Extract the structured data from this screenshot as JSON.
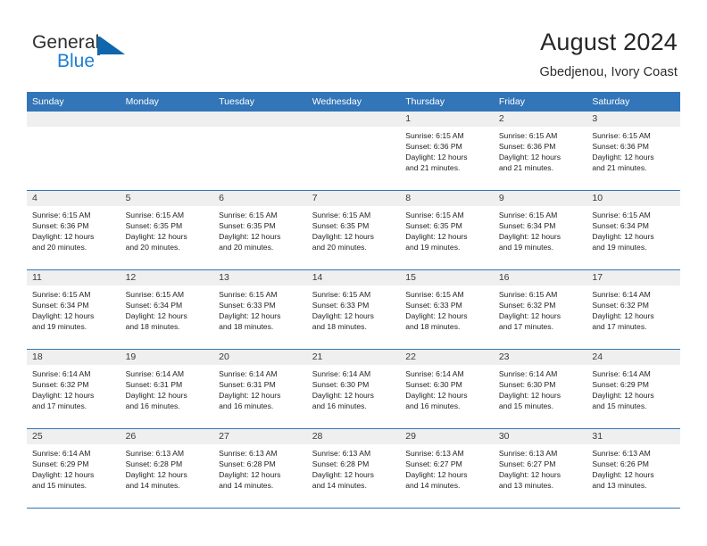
{
  "logo": {
    "text_primary": "General",
    "text_secondary": "Blue",
    "flag_icon": "blue-triangle-flag-icon",
    "accent_color": "#1b7fd4"
  },
  "header": {
    "title": "August 2024",
    "subtitle": "Gbedjenou, Ivory Coast"
  },
  "theme": {
    "header_blue": "#3275b8",
    "daynum_band": "#efefef",
    "cell_background": "#ffffff",
    "text_color": "#1f1f1f"
  },
  "weekday_headers": [
    "Sunday",
    "Monday",
    "Tuesday",
    "Wednesday",
    "Thursday",
    "Friday",
    "Saturday"
  ],
  "weeks": [
    [
      {
        "day": "",
        "empty": true,
        "sunrise": "",
        "sunset": "",
        "daylight_line1": "",
        "daylight_line2": ""
      },
      {
        "day": "",
        "empty": true,
        "sunrise": "",
        "sunset": "",
        "daylight_line1": "",
        "daylight_line2": ""
      },
      {
        "day": "",
        "empty": true,
        "sunrise": "",
        "sunset": "",
        "daylight_line1": "",
        "daylight_line2": ""
      },
      {
        "day": "",
        "empty": true,
        "sunrise": "",
        "sunset": "",
        "daylight_line1": "",
        "daylight_line2": ""
      },
      {
        "day": "1",
        "empty": false,
        "sunrise": "Sunrise: 6:15 AM",
        "sunset": "Sunset: 6:36 PM",
        "daylight_line1": "Daylight: 12 hours",
        "daylight_line2": "and 21 minutes."
      },
      {
        "day": "2",
        "empty": false,
        "sunrise": "Sunrise: 6:15 AM",
        "sunset": "Sunset: 6:36 PM",
        "daylight_line1": "Daylight: 12 hours",
        "daylight_line2": "and 21 minutes."
      },
      {
        "day": "3",
        "empty": false,
        "sunrise": "Sunrise: 6:15 AM",
        "sunset": "Sunset: 6:36 PM",
        "daylight_line1": "Daylight: 12 hours",
        "daylight_line2": "and 21 minutes."
      }
    ],
    [
      {
        "day": "4",
        "empty": false,
        "sunrise": "Sunrise: 6:15 AM",
        "sunset": "Sunset: 6:36 PM",
        "daylight_line1": "Daylight: 12 hours",
        "daylight_line2": "and 20 minutes."
      },
      {
        "day": "5",
        "empty": false,
        "sunrise": "Sunrise: 6:15 AM",
        "sunset": "Sunset: 6:35 PM",
        "daylight_line1": "Daylight: 12 hours",
        "daylight_line2": "and 20 minutes."
      },
      {
        "day": "6",
        "empty": false,
        "sunrise": "Sunrise: 6:15 AM",
        "sunset": "Sunset: 6:35 PM",
        "daylight_line1": "Daylight: 12 hours",
        "daylight_line2": "and 20 minutes."
      },
      {
        "day": "7",
        "empty": false,
        "sunrise": "Sunrise: 6:15 AM",
        "sunset": "Sunset: 6:35 PM",
        "daylight_line1": "Daylight: 12 hours",
        "daylight_line2": "and 20 minutes."
      },
      {
        "day": "8",
        "empty": false,
        "sunrise": "Sunrise: 6:15 AM",
        "sunset": "Sunset: 6:35 PM",
        "daylight_line1": "Daylight: 12 hours",
        "daylight_line2": "and 19 minutes."
      },
      {
        "day": "9",
        "empty": false,
        "sunrise": "Sunrise: 6:15 AM",
        "sunset": "Sunset: 6:34 PM",
        "daylight_line1": "Daylight: 12 hours",
        "daylight_line2": "and 19 minutes."
      },
      {
        "day": "10",
        "empty": false,
        "sunrise": "Sunrise: 6:15 AM",
        "sunset": "Sunset: 6:34 PM",
        "daylight_line1": "Daylight: 12 hours",
        "daylight_line2": "and 19 minutes."
      }
    ],
    [
      {
        "day": "11",
        "empty": false,
        "sunrise": "Sunrise: 6:15 AM",
        "sunset": "Sunset: 6:34 PM",
        "daylight_line1": "Daylight: 12 hours",
        "daylight_line2": "and 19 minutes."
      },
      {
        "day": "12",
        "empty": false,
        "sunrise": "Sunrise: 6:15 AM",
        "sunset": "Sunset: 6:34 PM",
        "daylight_line1": "Daylight: 12 hours",
        "daylight_line2": "and 18 minutes."
      },
      {
        "day": "13",
        "empty": false,
        "sunrise": "Sunrise: 6:15 AM",
        "sunset": "Sunset: 6:33 PM",
        "daylight_line1": "Daylight: 12 hours",
        "daylight_line2": "and 18 minutes."
      },
      {
        "day": "14",
        "empty": false,
        "sunrise": "Sunrise: 6:15 AM",
        "sunset": "Sunset: 6:33 PM",
        "daylight_line1": "Daylight: 12 hours",
        "daylight_line2": "and 18 minutes."
      },
      {
        "day": "15",
        "empty": false,
        "sunrise": "Sunrise: 6:15 AM",
        "sunset": "Sunset: 6:33 PM",
        "daylight_line1": "Daylight: 12 hours",
        "daylight_line2": "and 18 minutes."
      },
      {
        "day": "16",
        "empty": false,
        "sunrise": "Sunrise: 6:15 AM",
        "sunset": "Sunset: 6:32 PM",
        "daylight_line1": "Daylight: 12 hours",
        "daylight_line2": "and 17 minutes."
      },
      {
        "day": "17",
        "empty": false,
        "sunrise": "Sunrise: 6:14 AM",
        "sunset": "Sunset: 6:32 PM",
        "daylight_line1": "Daylight: 12 hours",
        "daylight_line2": "and 17 minutes."
      }
    ],
    [
      {
        "day": "18",
        "empty": false,
        "sunrise": "Sunrise: 6:14 AM",
        "sunset": "Sunset: 6:32 PM",
        "daylight_line1": "Daylight: 12 hours",
        "daylight_line2": "and 17 minutes."
      },
      {
        "day": "19",
        "empty": false,
        "sunrise": "Sunrise: 6:14 AM",
        "sunset": "Sunset: 6:31 PM",
        "daylight_line1": "Daylight: 12 hours",
        "daylight_line2": "and 16 minutes."
      },
      {
        "day": "20",
        "empty": false,
        "sunrise": "Sunrise: 6:14 AM",
        "sunset": "Sunset: 6:31 PM",
        "daylight_line1": "Daylight: 12 hours",
        "daylight_line2": "and 16 minutes."
      },
      {
        "day": "21",
        "empty": false,
        "sunrise": "Sunrise: 6:14 AM",
        "sunset": "Sunset: 6:30 PM",
        "daylight_line1": "Daylight: 12 hours",
        "daylight_line2": "and 16 minutes."
      },
      {
        "day": "22",
        "empty": false,
        "sunrise": "Sunrise: 6:14 AM",
        "sunset": "Sunset: 6:30 PM",
        "daylight_line1": "Daylight: 12 hours",
        "daylight_line2": "and 16 minutes."
      },
      {
        "day": "23",
        "empty": false,
        "sunrise": "Sunrise: 6:14 AM",
        "sunset": "Sunset: 6:30 PM",
        "daylight_line1": "Daylight: 12 hours",
        "daylight_line2": "and 15 minutes."
      },
      {
        "day": "24",
        "empty": false,
        "sunrise": "Sunrise: 6:14 AM",
        "sunset": "Sunset: 6:29 PM",
        "daylight_line1": "Daylight: 12 hours",
        "daylight_line2": "and 15 minutes."
      }
    ],
    [
      {
        "day": "25",
        "empty": false,
        "sunrise": "Sunrise: 6:14 AM",
        "sunset": "Sunset: 6:29 PM",
        "daylight_line1": "Daylight: 12 hours",
        "daylight_line2": "and 15 minutes."
      },
      {
        "day": "26",
        "empty": false,
        "sunrise": "Sunrise: 6:13 AM",
        "sunset": "Sunset: 6:28 PM",
        "daylight_line1": "Daylight: 12 hours",
        "daylight_line2": "and 14 minutes."
      },
      {
        "day": "27",
        "empty": false,
        "sunrise": "Sunrise: 6:13 AM",
        "sunset": "Sunset: 6:28 PM",
        "daylight_line1": "Daylight: 12 hours",
        "daylight_line2": "and 14 minutes."
      },
      {
        "day": "28",
        "empty": false,
        "sunrise": "Sunrise: 6:13 AM",
        "sunset": "Sunset: 6:28 PM",
        "daylight_line1": "Daylight: 12 hours",
        "daylight_line2": "and 14 minutes."
      },
      {
        "day": "29",
        "empty": false,
        "sunrise": "Sunrise: 6:13 AM",
        "sunset": "Sunset: 6:27 PM",
        "daylight_line1": "Daylight: 12 hours",
        "daylight_line2": "and 14 minutes."
      },
      {
        "day": "30",
        "empty": false,
        "sunrise": "Sunrise: 6:13 AM",
        "sunset": "Sunset: 6:27 PM",
        "daylight_line1": "Daylight: 12 hours",
        "daylight_line2": "and 13 minutes."
      },
      {
        "day": "31",
        "empty": false,
        "sunrise": "Sunrise: 6:13 AM",
        "sunset": "Sunset: 6:26 PM",
        "daylight_line1": "Daylight: 12 hours",
        "daylight_line2": "and 13 minutes."
      }
    ]
  ]
}
